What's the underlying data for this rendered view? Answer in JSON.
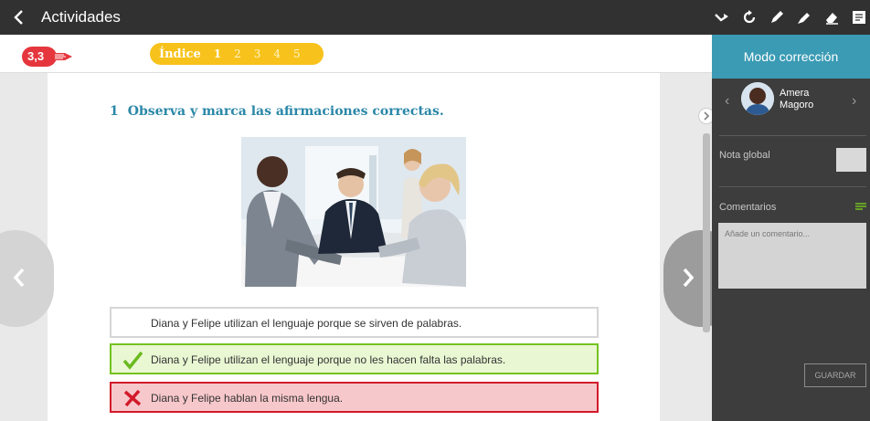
{
  "app": {
    "title": "Actividades",
    "tools": [
      "arrow-icon",
      "refresh-icon",
      "pen-icon",
      "marker-icon",
      "eraser-icon",
      "note-icon"
    ]
  },
  "index_bar": {
    "label": "Índice",
    "pages": [
      "1",
      "2",
      "3",
      "4",
      "5"
    ],
    "active_page": "1",
    "color": "#f7c21b"
  },
  "score": {
    "value": "3,3",
    "color": "#e5363d"
  },
  "question": {
    "number": "1",
    "text": "Observa y marca las afirmaciones correctas.",
    "options": [
      {
        "text": "Diana y Felipe utilizan el lenguaje porque se sirven de palabras.",
        "state": "none"
      },
      {
        "text": "Diana y Felipe utilizan el lenguaje porque no les hacen falta las palabras.",
        "state": "correct"
      },
      {
        "text": "Diana y Felipe hablan la misma lengua.",
        "state": "wrong"
      }
    ]
  },
  "panel": {
    "header": "Modo corrección",
    "student_first": "Amera",
    "student_last": "Magoro",
    "grade_label": "Nota global",
    "comments_label": "Comentarios",
    "comment_placeholder": "Añade un comentario...",
    "save_label": "GUARDAR",
    "accent": "#3b9bb4"
  }
}
